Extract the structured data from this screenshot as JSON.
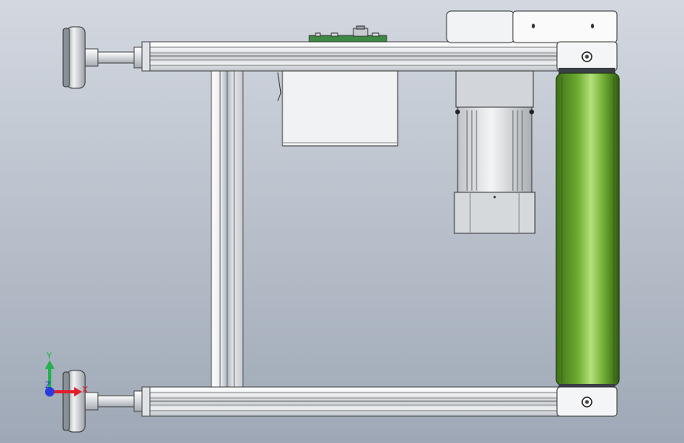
{
  "viewport": {
    "background_top": "#d3d8e0",
    "background_bottom": "#9ea8b6"
  },
  "model": {
    "components": [
      {
        "name": "leveling-foot-top",
        "kind": "leveling foot"
      },
      {
        "name": "leveling-foot-bottom",
        "kind": "leveling foot"
      },
      {
        "name": "top-aluminum-profile",
        "kind": "aluminum extrusion"
      },
      {
        "name": "bottom-aluminum-profile",
        "kind": "aluminum extrusion"
      },
      {
        "name": "vertical-support-profile",
        "kind": "aluminum extrusion"
      },
      {
        "name": "control-box",
        "kind": "electrical box"
      },
      {
        "name": "gear-motor",
        "kind": "motor"
      },
      {
        "name": "conveyor-belt-roller",
        "kind": "belt / roller"
      },
      {
        "name": "end-cap-top",
        "kind": "end bracket"
      },
      {
        "name": "end-cap-bottom",
        "kind": "end bracket"
      }
    ],
    "colors": {
      "belt": "#5e9a2c",
      "belt_highlight": "#a6d86a",
      "profile": "#e2e6ea",
      "profile_shadow": "#9aa2ac",
      "motor": "#d8dadd",
      "pcb": "#3d8a45"
    }
  },
  "triad": {
    "x_label": "X",
    "y_label": "Y",
    "z_label": "Z",
    "x_color": "#e0202a",
    "y_color": "#22b14c",
    "z_color": "#2a3cdc"
  }
}
